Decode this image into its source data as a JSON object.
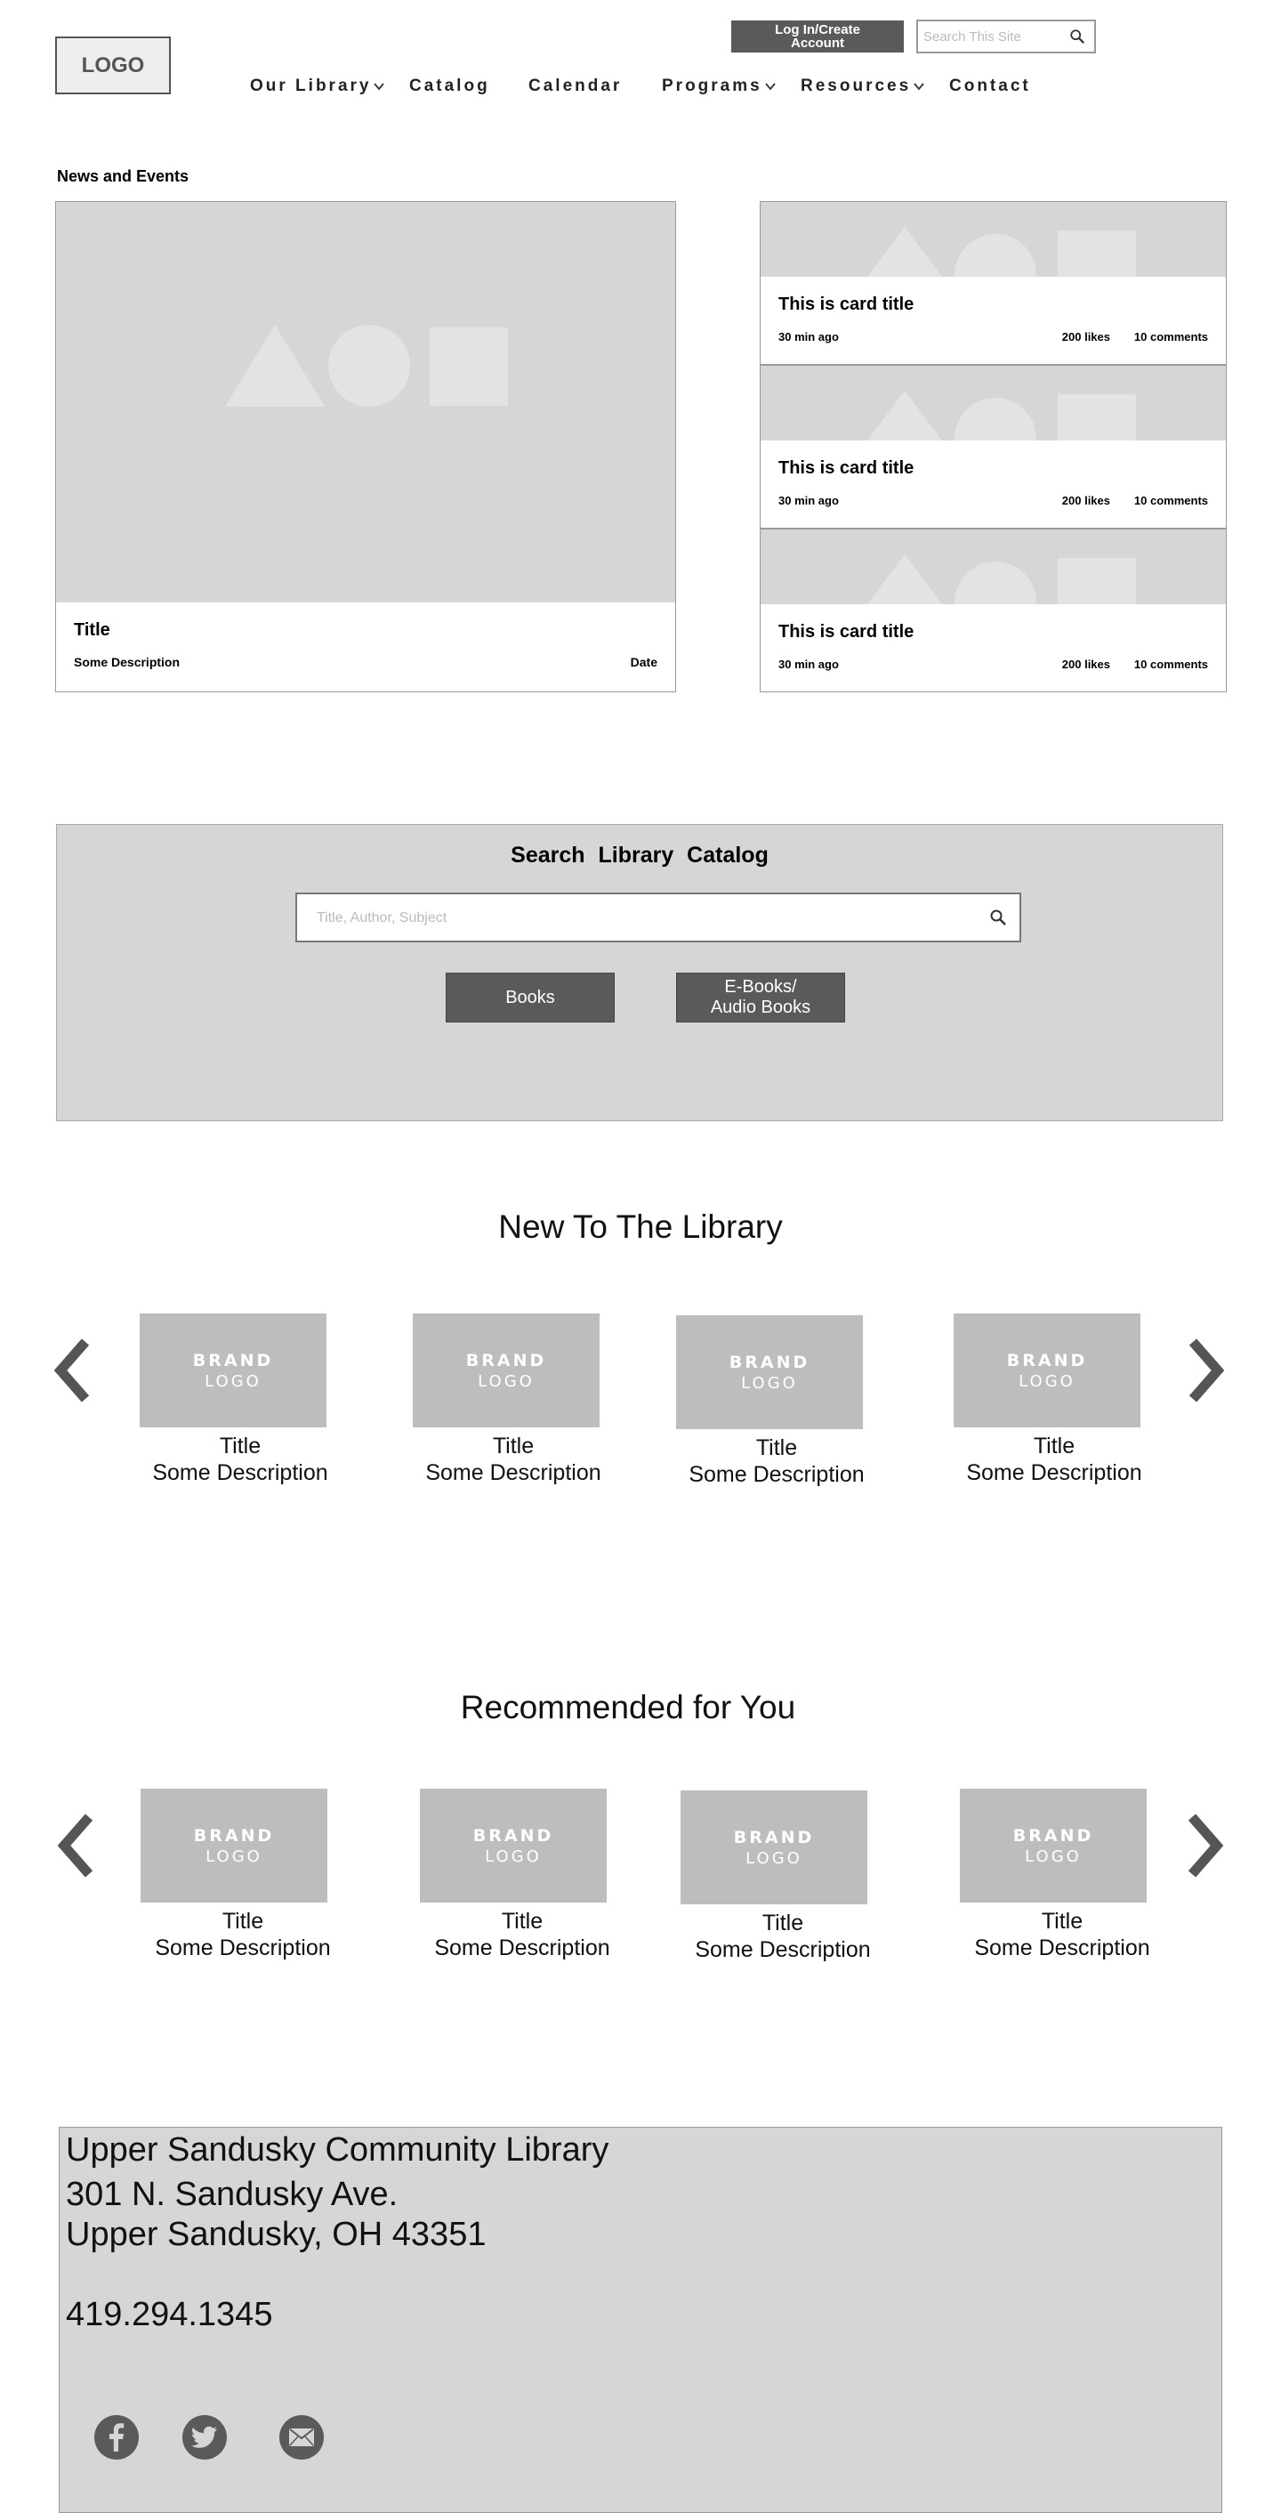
{
  "header": {
    "logo": "LOGO",
    "login_label": "Log In/Create Account",
    "search_placeholder": "Search This Site",
    "nav": [
      "Our Library",
      "Catalog",
      "Calendar",
      "Programs",
      "Resources",
      "Contact"
    ]
  },
  "news": {
    "section_label": "News and Events",
    "feature": {
      "title": "Title",
      "description": "Some Description",
      "date": "Date"
    },
    "cards": [
      {
        "title": "This is card title",
        "time": "30 min ago",
        "likes": "200 likes",
        "comments": "10 comments"
      },
      {
        "title": "This is card title",
        "time": "30 min ago",
        "likes": "200 likes",
        "comments": "10 comments"
      },
      {
        "title": "This is card title",
        "time": "30 min ago",
        "likes": "200 likes",
        "comments": "10 comments"
      }
    ]
  },
  "catalog": {
    "title": "Search Library Catalog",
    "placeholder": "Title, Author, Subject",
    "books_label": "Books",
    "ebooks_label_line1": "E-Books/",
    "ebooks_label_line2": "Audio Books"
  },
  "new_to_library": {
    "heading": "New To The Library",
    "items": [
      {
        "brand": "BRAND",
        "logo": "LOGO",
        "title": "Title",
        "description": "Some Description"
      },
      {
        "brand": "BRAND",
        "logo": "LOGO",
        "title": "Title",
        "description": "Some Description"
      },
      {
        "brand": "BRAND",
        "logo": "LOGO",
        "title": "Title",
        "description": "Some Description"
      },
      {
        "brand": "BRAND",
        "logo": "LOGO",
        "title": "Title",
        "description": "Some Description"
      }
    ]
  },
  "recommended": {
    "heading": "Recommended for You",
    "items": [
      {
        "brand": "BRAND",
        "logo": "LOGO",
        "title": "Title",
        "description": "Some Description"
      },
      {
        "brand": "BRAND",
        "logo": "LOGO",
        "title": "Title",
        "description": "Some Description"
      },
      {
        "brand": "BRAND",
        "logo": "LOGO",
        "title": "Title",
        "description": "Some Description"
      },
      {
        "brand": "BRAND",
        "logo": "LOGO",
        "title": "Title",
        "description": "Some Description"
      }
    ]
  },
  "footer": {
    "name": "Upper Sandusky Community Library",
    "address_line1": "301 N. Sandusky Ave.",
    "address_line2": "Upper Sandusky, OH 43351",
    "phone": "419.294.1345",
    "social": [
      "facebook-icon",
      "twitter-icon",
      "email-icon"
    ]
  },
  "colors": {
    "placeholder_gray": "#d6d6d6",
    "brand_gray": "#bdbdbd",
    "button_dark": "#5a5a5a"
  }
}
